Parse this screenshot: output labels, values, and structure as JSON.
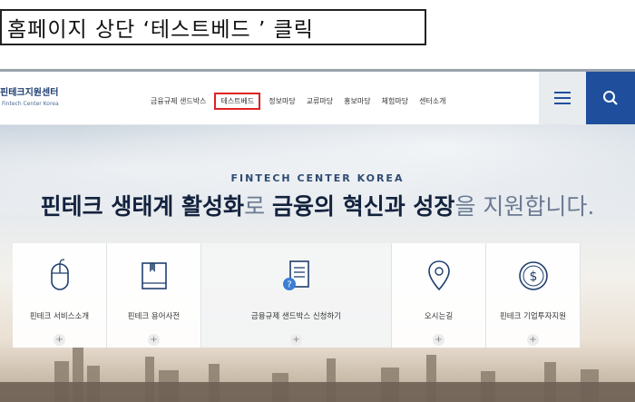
{
  "caption": "홈페이지 상단 ‘테스트베드 ’ 클릭",
  "header": {
    "logo_main": "핀테크지원센터",
    "logo_sub": "Fintech Center Korea",
    "nav": [
      "금융규제 샌드박스",
      "테스트베드",
      "정보마당",
      "교류마당",
      "홍보마당",
      "체험마당",
      "센터소개"
    ],
    "highlighted_nav": "테스트베드",
    "menu_icon": "hamburger-icon",
    "search_icon": "search-icon"
  },
  "hero": {
    "subtitle": "FINTECH CENTER KOREA",
    "headline": {
      "p1": "핀테크 생태계 활성화",
      "p2": "로 ",
      "p3": "금융의 혁신과 성장",
      "p4": "을 지원합니다."
    }
  },
  "cards": [
    {
      "label": "핀테크 서비스소개",
      "icon": "mouse-icon"
    },
    {
      "label": "핀테크 용어사전",
      "icon": "book-icon"
    },
    {
      "label": "금융규제 샌드박스 신청하기",
      "icon": "document-question-icon"
    },
    {
      "label": "오시는길",
      "icon": "location-pin-icon"
    },
    {
      "label": "핀테크 기업투자지원",
      "icon": "dollar-coin-icon"
    }
  ],
  "card_plus": "+",
  "colors": {
    "accent": "#1f4f9c",
    "highlight": "#dd2222",
    "headline": "#1b2a44"
  }
}
